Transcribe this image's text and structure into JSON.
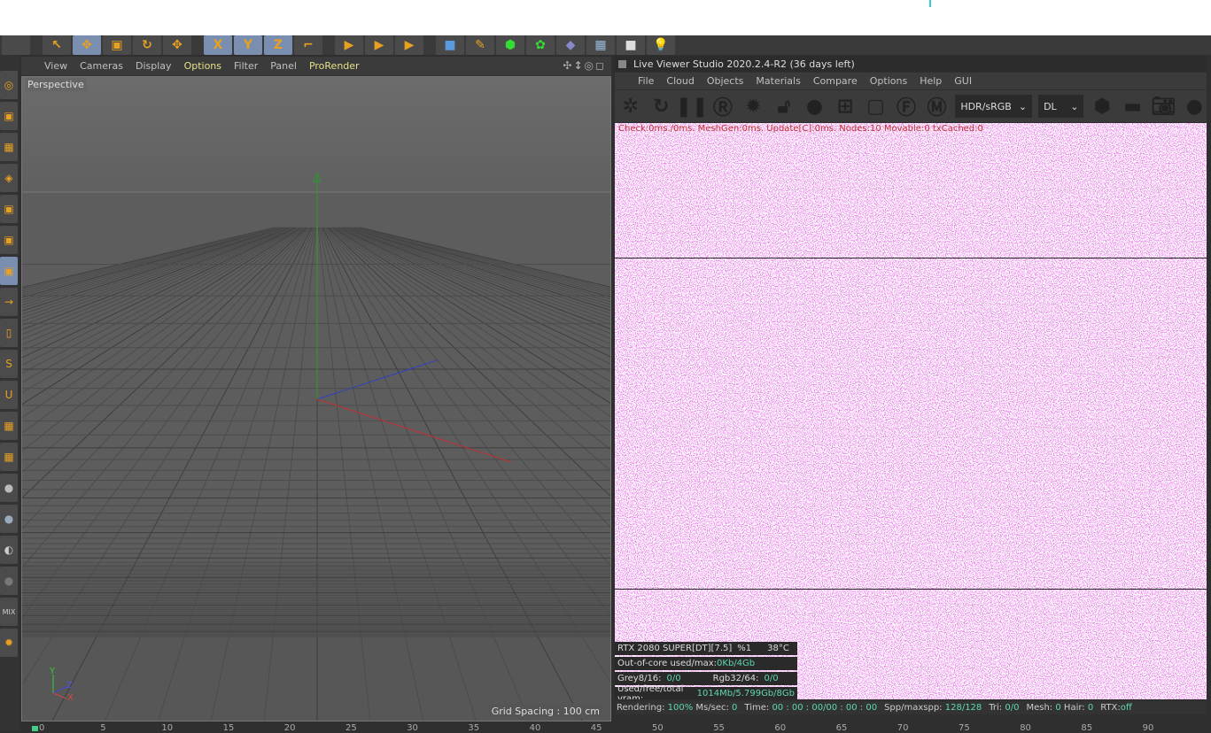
{
  "viewport": {
    "menu": [
      {
        "label": "View",
        "highlight": false
      },
      {
        "label": "Cameras",
        "highlight": false
      },
      {
        "label": "Display",
        "highlight": false
      },
      {
        "label": "Options",
        "highlight": true
      },
      {
        "label": "Filter",
        "highlight": false
      },
      {
        "label": "Panel",
        "highlight": false
      },
      {
        "label": "ProRender",
        "highlight": true
      }
    ],
    "camera": "Perspective",
    "grid_spacing": "Grid Spacing : 100 cm",
    "axis_labels": {
      "y": "Y",
      "z": "Z",
      "x": "X"
    },
    "nav_icons": [
      "move-view-icon",
      "dolly-icon",
      "rotate-view-icon",
      "maximize-icon"
    ]
  },
  "toolbar": {
    "axis_buttons": [
      "X",
      "Y",
      "Z"
    ]
  },
  "live_viewer": {
    "title": "Live Viewer Studio 2020.2.4-R2 (36 days left)",
    "menu": [
      "File",
      "Cloud",
      "Objects",
      "Materials",
      "Compare",
      "Options",
      "Help",
      "GUI"
    ],
    "tools": [
      "send-scene-icon",
      "restart-icon",
      "pause-icon",
      "region-icon",
      "settings-gear-icon",
      "lock-icon",
      "material-ball-icon",
      "add-region-icon",
      "clear-icon",
      "focus-icon",
      "material-pick-icon"
    ],
    "color_space": "HDR/sRGB",
    "kernel": "DL",
    "check_line": "Check:0ms./0ms. MeshGen:0ms. Update[C]:0ms. Nodes:10 Movable:0 txCached:0",
    "gpu": {
      "name": "RTX 2080 SUPER[DT][7.5]",
      "usage": "%1",
      "temp": "38°C"
    },
    "out_of_core": {
      "label": "Out-of-core used/max:",
      "value": "0Kb/4Gb"
    },
    "grey": {
      "label": "Grey8/16:",
      "value": "0/0"
    },
    "rgb": {
      "label": "Rgb32/64:",
      "value": "0/0"
    },
    "vram": {
      "label": "Used/free/total vram:",
      "value": "1014Mb/5.799Gb/8Gb"
    },
    "status": {
      "rendering_label": "Rendering:",
      "rendering": "100%",
      "ms_label": "Ms/sec:",
      "ms": "0",
      "time_label": "Time:",
      "time": "00 : 00 : 00/00 : 00 : 00",
      "spp_label": "Spp/maxspp:",
      "spp": "128/128",
      "tri_label": "Tri:",
      "tri": "0/0",
      "mesh_label": "Mesh:",
      "mesh": "0",
      "hair_label": "Hair:",
      "hair": "0",
      "rtx_label": "RTX:",
      "rtx": "off"
    },
    "noise_color": "#d040d0"
  },
  "timeline": {
    "ticks": [
      "0",
      "5",
      "10",
      "15",
      "20",
      "25",
      "30",
      "35",
      "40",
      "45",
      "50",
      "55",
      "60",
      "65",
      "70",
      "75",
      "80",
      "85",
      "90"
    ]
  }
}
